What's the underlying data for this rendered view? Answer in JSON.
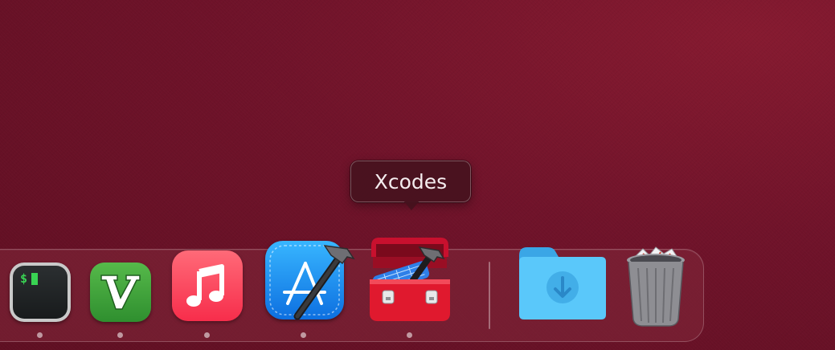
{
  "tooltip": {
    "label": "Xcodes"
  },
  "dock": {
    "apps": [
      {
        "name": "terminal",
        "icon": "terminal-icon",
        "running": true,
        "prompt": "$"
      },
      {
        "name": "vim",
        "icon": "vim-icon",
        "running": true,
        "glyph": "V"
      },
      {
        "name": "music",
        "icon": "music-icon",
        "running": true
      },
      {
        "name": "xcode",
        "icon": "xcode-icon",
        "running": true
      },
      {
        "name": "xcodes",
        "icon": "xcodes-icon",
        "running": true
      }
    ],
    "stacks": [
      {
        "name": "downloads",
        "icon": "downloads-folder-icon"
      },
      {
        "name": "trash",
        "icon": "trash-icon"
      }
    ]
  },
  "colors": {
    "wallpaper": "#70132a",
    "terminal_green": "#39d353",
    "music_red": "#f72d4b",
    "xcode_blue": "#1a8cf0",
    "xcodes_red": "#e0192e",
    "folder_blue": "#5ac8fa"
  }
}
